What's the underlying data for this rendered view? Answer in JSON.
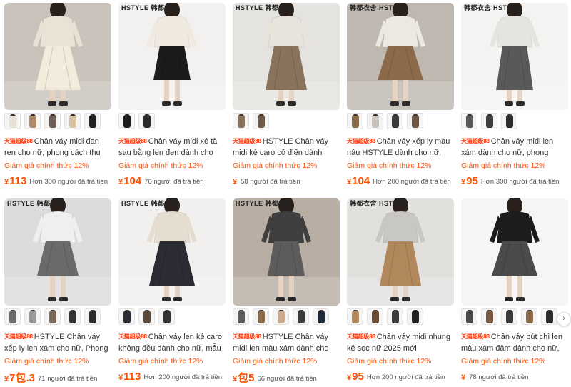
{
  "products": [
    {
      "brand": "",
      "tag": "天猫超级88",
      "title": "Chân váy midi đan ren cho nữ, phong cách thu",
      "promo": "Giảm giá chính thức 12%",
      "price": "113",
      "sold": "Hơn 300 người đã trả tiền",
      "colors": {
        "bg": "#c9c3bb",
        "top": "#e9e3d6",
        "skirt": "#f3ecdd"
      },
      "thumbs": [
        "#e8e2d6",
        "#b08b6c",
        "#6d5d52",
        "#d6c3a4",
        "#222222"
      ]
    },
    {
      "brand": "HSTYLE 韩都衣舍",
      "tag": "天猫超级88",
      "title": "Chân váy midi xẻ tà sau bằng len đen dành cho",
      "promo": "Giảm giá chính thức 12%",
      "price": "104",
      "sold": "76 người đã trả tiền",
      "colors": {
        "bg": "#f2f1ef",
        "top": "#efe9e0",
        "skirt": "#1b1b1b"
      },
      "thumbs": [
        "#1b1b1b",
        "#2a2a2a"
      ]
    },
    {
      "brand": "HSTYLE 韩都衣舍",
      "tag": "天猫超级88",
      "title": "HSTYLE Chân váy midi kẻ caro cổ điển dành",
      "promo": "Giảm giá chính thức 12%",
      "price": "",
      "sold": "58 người đã trả tiền",
      "colors": {
        "bg": "#e4e3e0",
        "top": "#e8e4dc",
        "skirt": "#8a735d"
      },
      "thumbs": [
        "#8a735d",
        "#6f5a48"
      ]
    },
    {
      "brand": "韩都衣舍 HSTYLE",
      "tag": "天猫超级88",
      "title": "Chân váy xếp ly màu nâu HSTYLE dành cho nữ,",
      "promo": "Giảm giá chính thức 12%",
      "price": "104",
      "sold": "Hơn 200 người đã trả tiền",
      "colors": {
        "bg": "#bfb8b0",
        "top": "#ece8e2",
        "skirt": "#8b6a4a"
      },
      "thumbs": [
        "#8b6a4a",
        "#c9c4bd",
        "#3a3a3a",
        "#6f5a48"
      ]
    },
    {
      "brand": "韩都衣舍 HSTYLE",
      "tag": "天猫超级88",
      "title": "Chân váy midi len xám dành cho nữ, phong",
      "promo": "Giảm giá chính thức 12%",
      "price": "95",
      "sold": "Hơn 300 người đã trả tiền",
      "colors": {
        "bg": "#f3f3f2",
        "top": "#e6e4df",
        "skirt": "#595959"
      },
      "thumbs": [
        "#595959",
        "#3d3d3d",
        "#2a2a2a"
      ]
    },
    {
      "brand": "HSTYLE 韩都衣舍",
      "tag": "天猫超级88",
      "title": "HSTYLE Chân váy xếp ly len xám cho nữ, Phong",
      "promo": "Giảm giá chính thức 12%",
      "price": "7包.3",
      "sold": "71 người đã trả tiền",
      "colors": {
        "bg": "#dcdcdc",
        "top": "#efefef",
        "skirt": "#6a6a6a"
      },
      "thumbs": [
        "#6a6a6a",
        "#9a9a9a",
        "#7a6a5a",
        "#333333",
        "#2a2a2a"
      ]
    },
    {
      "brand": "HSTYLE 韩都衣舍",
      "tag": "天猫超级88",
      "title": "Chân váy len kẻ caro không đều dành cho nữ, mẫu",
      "promo": "Giảm giá chính thức 12%",
      "price": "113",
      "sold": "Hơn 200 người đã trả tiền",
      "colors": {
        "bg": "#f1f0ee",
        "top": "#e5ddcf",
        "skirt": "#2b2b33"
      },
      "thumbs": [
        "#2b2b33",
        "#5b4a3c",
        "#333333"
      ]
    },
    {
      "brand": "HSTYLE 韩都衣舍",
      "tag": "天猫超级88",
      "title": "HSTYLE Chân váy midi len màu xám dành cho",
      "promo": "Giảm giá chính thức 12%",
      "price": "包5",
      "sold": "66 người đã trả tiền",
      "colors": {
        "bg": "#b9aea4",
        "top": "#3f3f3f",
        "skirt": "#5c5c5c"
      },
      "thumbs": [
        "#5c5c5c",
        "#8b6a4a",
        "#caa98a",
        "#3a3a3a",
        "#1f2a3a"
      ]
    },
    {
      "brand": "韩都衣舍 HSTYLE",
      "tag": "天猫超级88",
      "title": "Chân váy midi nhung kẻ sọc nữ 2025 mới",
      "promo": "Giảm giá chính thức 12%",
      "price": "95",
      "sold": "Hơn 200 người đã trả tiền",
      "colors": {
        "bg": "#e2e0dd",
        "top": "#c9c7c3",
        "skirt": "#b0885c"
      },
      "thumbs": [
        "#b0885c",
        "#6b4e36",
        "#3a3a3a",
        "#222222"
      ]
    },
    {
      "brand": "",
      "tag": "天猫超级88",
      "title": "Chân váy bút chì len màu xám đậm dành cho nữ,",
      "promo": "Giảm giá chính thức 12%",
      "price": "",
      "sold": "78 người đã trả tiền",
      "colors": {
        "bg": "#f5f5f4",
        "top": "#1c1c1c",
        "skirt": "#4a4a4a"
      },
      "thumbs": [
        "#4a4a4a",
        "#7a5a44",
        "#3a3a3a",
        "#8b6a4a",
        "#2a2a2a"
      ]
    }
  ],
  "currency": "¥",
  "carousel_next": "›"
}
